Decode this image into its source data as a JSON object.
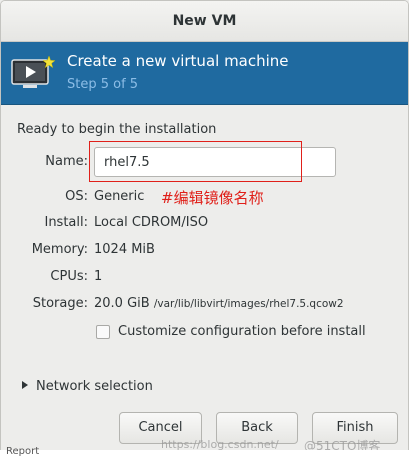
{
  "window": {
    "title": "New VM"
  },
  "banner": {
    "title": "Create a new virtual machine",
    "step": "Step 5 of 5",
    "icon": "monitor-with-star-icon"
  },
  "section": {
    "title": "Ready to begin the installation"
  },
  "fields": {
    "name_label": "Name:",
    "name_value": "rhel7.5",
    "os_label": "OS:",
    "os_value": "Generic",
    "install_label": "Install:",
    "install_value": "Local CDROM/ISO",
    "memory_label": "Memory:",
    "memory_value": "1024 MiB",
    "cpus_label": "CPUs:",
    "cpus_value": "1",
    "storage_label": "Storage:",
    "storage_size": "20.0 GiB",
    "storage_path": "/var/lib/libvirt/images/rhel7.5.qcow2"
  },
  "annotation": {
    "text": "#编辑镜像名称",
    "color": "#e0201a"
  },
  "customize": {
    "label": "Customize configuration before install",
    "checked": false
  },
  "network": {
    "label": "Network selection"
  },
  "buttons": {
    "cancel": "Cancel",
    "back": "Back",
    "finish": "Finish"
  },
  "watermark": {
    "url": "https://blog.csdn.net/",
    "brand": "@51CTO博客"
  },
  "bottom_text": "Report",
  "colors": {
    "banner": "#1f6aa0",
    "banner_step": "#8cbde6",
    "annotation": "#e0201a"
  }
}
